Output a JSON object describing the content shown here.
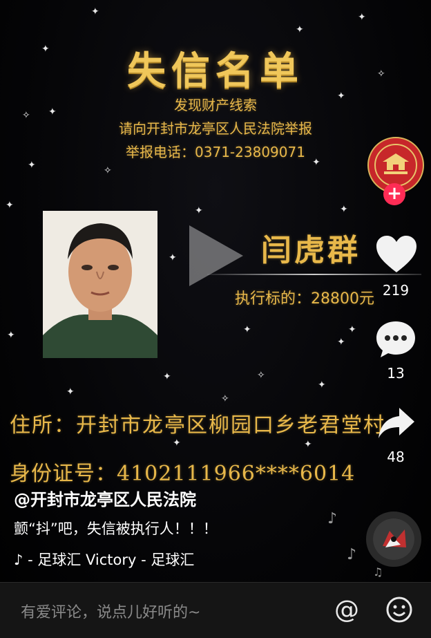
{
  "poster": {
    "title": "失信名单",
    "line1": "发现财产线索",
    "line2": "请向开封市龙亭区人民法院举报",
    "line3": "举报电话：0371-23809071",
    "name": "闫虎群",
    "target": "执行标的：28800元",
    "address": "住所：开封市龙亭区柳园口乡老君堂村",
    "id_number": "身份证号：4102111966****6014"
  },
  "sidebar": {
    "likes": "219",
    "comments": "13",
    "shares": "48",
    "follow_symbol": "+"
  },
  "caption": {
    "handle": "@开封市龙亭区人民法院",
    "description": "颤“抖”吧，失信被执行人！！！",
    "music": "♪  - 足球汇    Victory - 足球汇"
  },
  "bottom_bar": {
    "comment_placeholder": "有爱评论，说点儿好听的~",
    "at_symbol": "@"
  },
  "colors": {
    "gold": "#e8b84a",
    "accent": "#fe2c55"
  }
}
